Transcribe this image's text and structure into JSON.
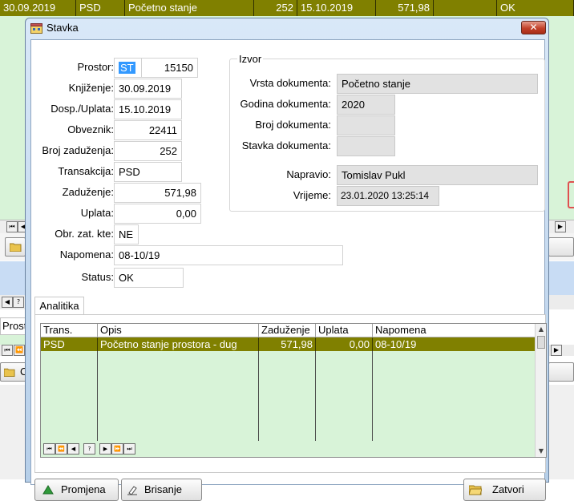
{
  "background": {
    "top_row": [
      "30.09.2019",
      "PSD",
      "Početno stanje",
      "252",
      "15.10.2019",
      "571,98",
      "",
      "OK"
    ],
    "fragments": {
      "left_tab_text": "Prosto",
      "left_row_text": "C"
    }
  },
  "dialog": {
    "title": "Stavka",
    "close_glyph": "✕",
    "form": {
      "prostor_label": "Prostor:",
      "prostor_code": "ST",
      "prostor_number": "15150",
      "knjizenje_label": "Knjiženje:",
      "knjizenje_value": "30.09.2019",
      "dosp_label": "Dosp./Uplata:",
      "dosp_value": "15.10.2019",
      "obveznik_label": "Obveznik:",
      "obveznik_value": "22411",
      "broj_zaduzenja_label": "Broj zaduženja:",
      "broj_zaduzenja_value": "252",
      "transakcija_label": "Transakcija:",
      "transakcija_value": "PSD",
      "zaduzenje_label": "Zaduženje:",
      "zaduzenje_value": "571,98",
      "uplata_label": "Uplata:",
      "uplata_value": "0,00",
      "obr_label": "Obr. zat. kte:",
      "obr_value": "NE",
      "napomena_label": "Napomena:",
      "napomena_value": "08-10/19",
      "status_label": "Status:",
      "status_value": "OK"
    },
    "izvor": {
      "legend": "Izvor",
      "vrsta_label": "Vrsta dokumenta:",
      "vrsta_value": "Početno stanje",
      "godina_label": "Godina dokumenta:",
      "godina_value": "2020",
      "broj_label": "Broj dokumenta:",
      "broj_value": "",
      "stavka_label": "Stavka dokumenta:",
      "stavka_value": "",
      "napravio_label": "Napravio:",
      "napravio_value": "Tomislav Pukl",
      "vrijeme_label": "Vrijeme:",
      "vrijeme_value": "23.01.2020 13:25:14"
    },
    "tab_label": "Analitika",
    "grid": {
      "columns": [
        "Trans.",
        "Opis",
        "Zaduženje",
        "Uplata",
        "Napomena"
      ],
      "rows": [
        [
          "PSD",
          "Početno stanje prostora - dug",
          "571,98",
          "0,00",
          "08-10/19"
        ]
      ]
    },
    "nav_buttons": [
      "⏮",
      "⏪",
      "◀",
      "?",
      "▶",
      "⏩",
      "⏭"
    ],
    "buttons": {
      "promjena": "Promjena",
      "brisanje": "Brisanje",
      "zatvori": "Zatvori"
    }
  },
  "colors": {
    "selection": "#808000",
    "grid_bg": "#d8f3d8",
    "accent_blue": "#3399ff"
  }
}
